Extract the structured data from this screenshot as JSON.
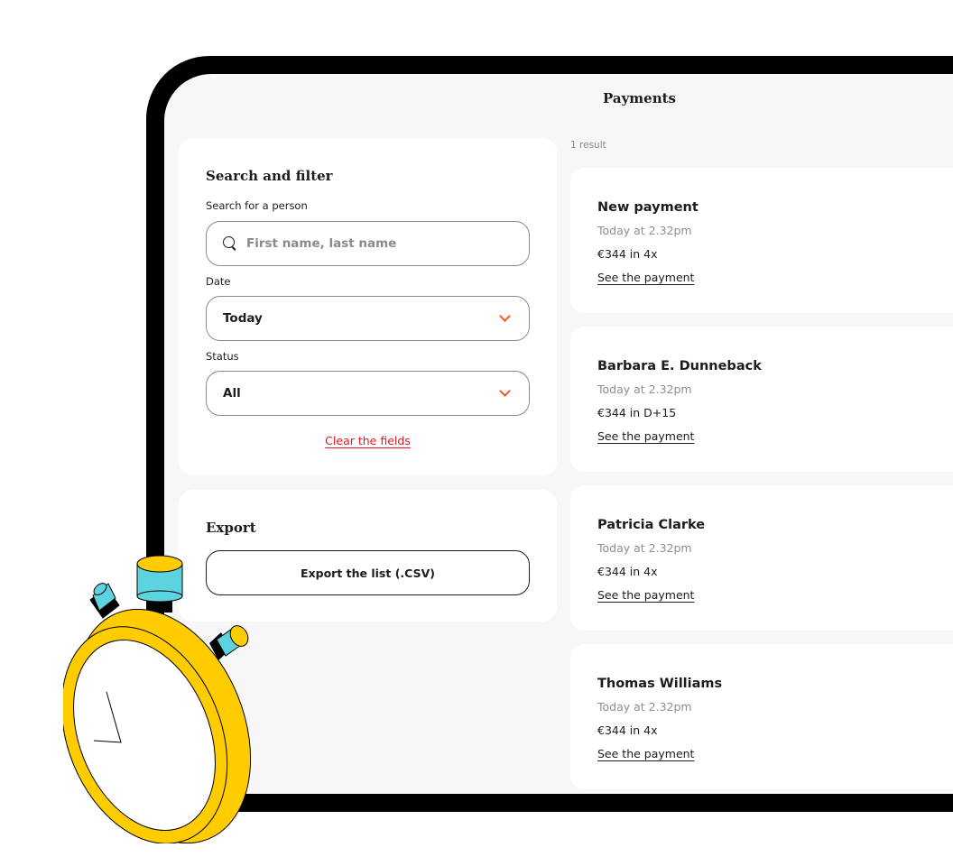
{
  "header": {
    "title": "Payments"
  },
  "filter": {
    "heading": "Search and filter",
    "search_label": "Search for a person",
    "search_placeholder": "First name, last name",
    "search_value": "",
    "date_label": "Date",
    "date_value": "Today",
    "status_label": "Status",
    "status_value": "All",
    "clear_label": "Clear the fields"
  },
  "export": {
    "heading": "Export",
    "button_label": "Export the list (.CSV)"
  },
  "results": {
    "count_label": "1 result",
    "items": [
      {
        "name": "New payment",
        "time": "Today at 2.32pm",
        "amount": "€344 in 4x",
        "link": "See the payment"
      },
      {
        "name": "Barbara E. Dunneback",
        "time": "Today at 2.32pm",
        "amount": "€344 in D+15",
        "link": "See the payment"
      },
      {
        "name": "Patricia Clarke",
        "time": "Today at 2.32pm",
        "amount": "€344 in 4x",
        "link": "See the payment"
      },
      {
        "name": "Thomas Williams",
        "time": "Today at 2.32pm",
        "amount": "€344 in 4x",
        "link": "See the payment"
      }
    ]
  },
  "colors": {
    "accent_chevron": "#f25a23",
    "clear_link": "#e8141e",
    "stopwatch_body": "#ffcc00",
    "stopwatch_buttons": "#5ed3e0",
    "screen_bg": "#f7f7f7"
  },
  "icons": {
    "search": "search-icon",
    "chevron": "chevron-down-icon",
    "illustration": "stopwatch-icon"
  }
}
